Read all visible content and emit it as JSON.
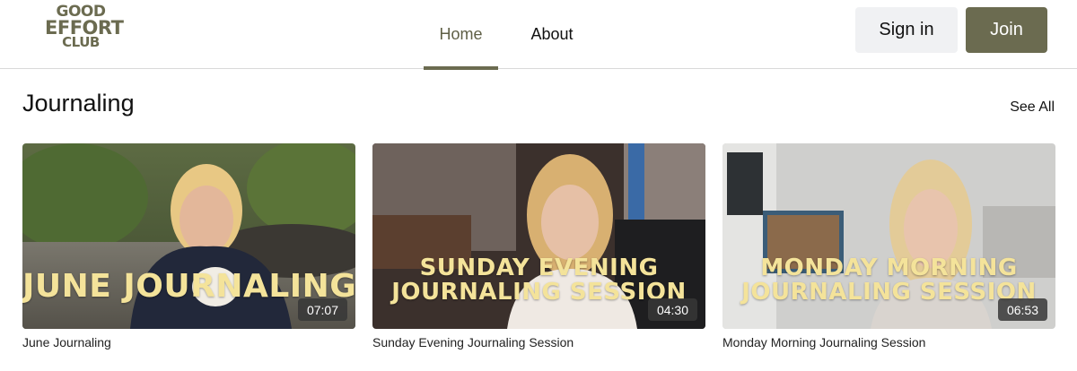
{
  "brand": {
    "logo_line1": "GOOD",
    "logo_line2": "EFFORT",
    "logo_line3": "CLUB",
    "color": "#6b6b50"
  },
  "nav": {
    "home": "Home",
    "about": "About",
    "active": "Home"
  },
  "auth": {
    "signin": "Sign in",
    "join": "Join"
  },
  "section": {
    "title": "Journaling",
    "see_all": "See All"
  },
  "videos": [
    {
      "overlay_line1": "JUNE JOURNALING",
      "overlay_line2": "",
      "duration": "07:07",
      "title": "June Journaling"
    },
    {
      "overlay_line1": "SUNDAY EVENING",
      "overlay_line2": "JOURNALING SESSION",
      "duration": "04:30",
      "title": "Sunday Evening Journaling Session"
    },
    {
      "overlay_line1": "MONDAY MORNING",
      "overlay_line2": "JOURNALING SESSION",
      "duration": "06:53",
      "title": "Monday Morning Journaling Session"
    }
  ],
  "colors": {
    "accent": "#6b6b50",
    "overlay_text": "#f4e39a",
    "signin_bg": "#f0f1f3"
  }
}
